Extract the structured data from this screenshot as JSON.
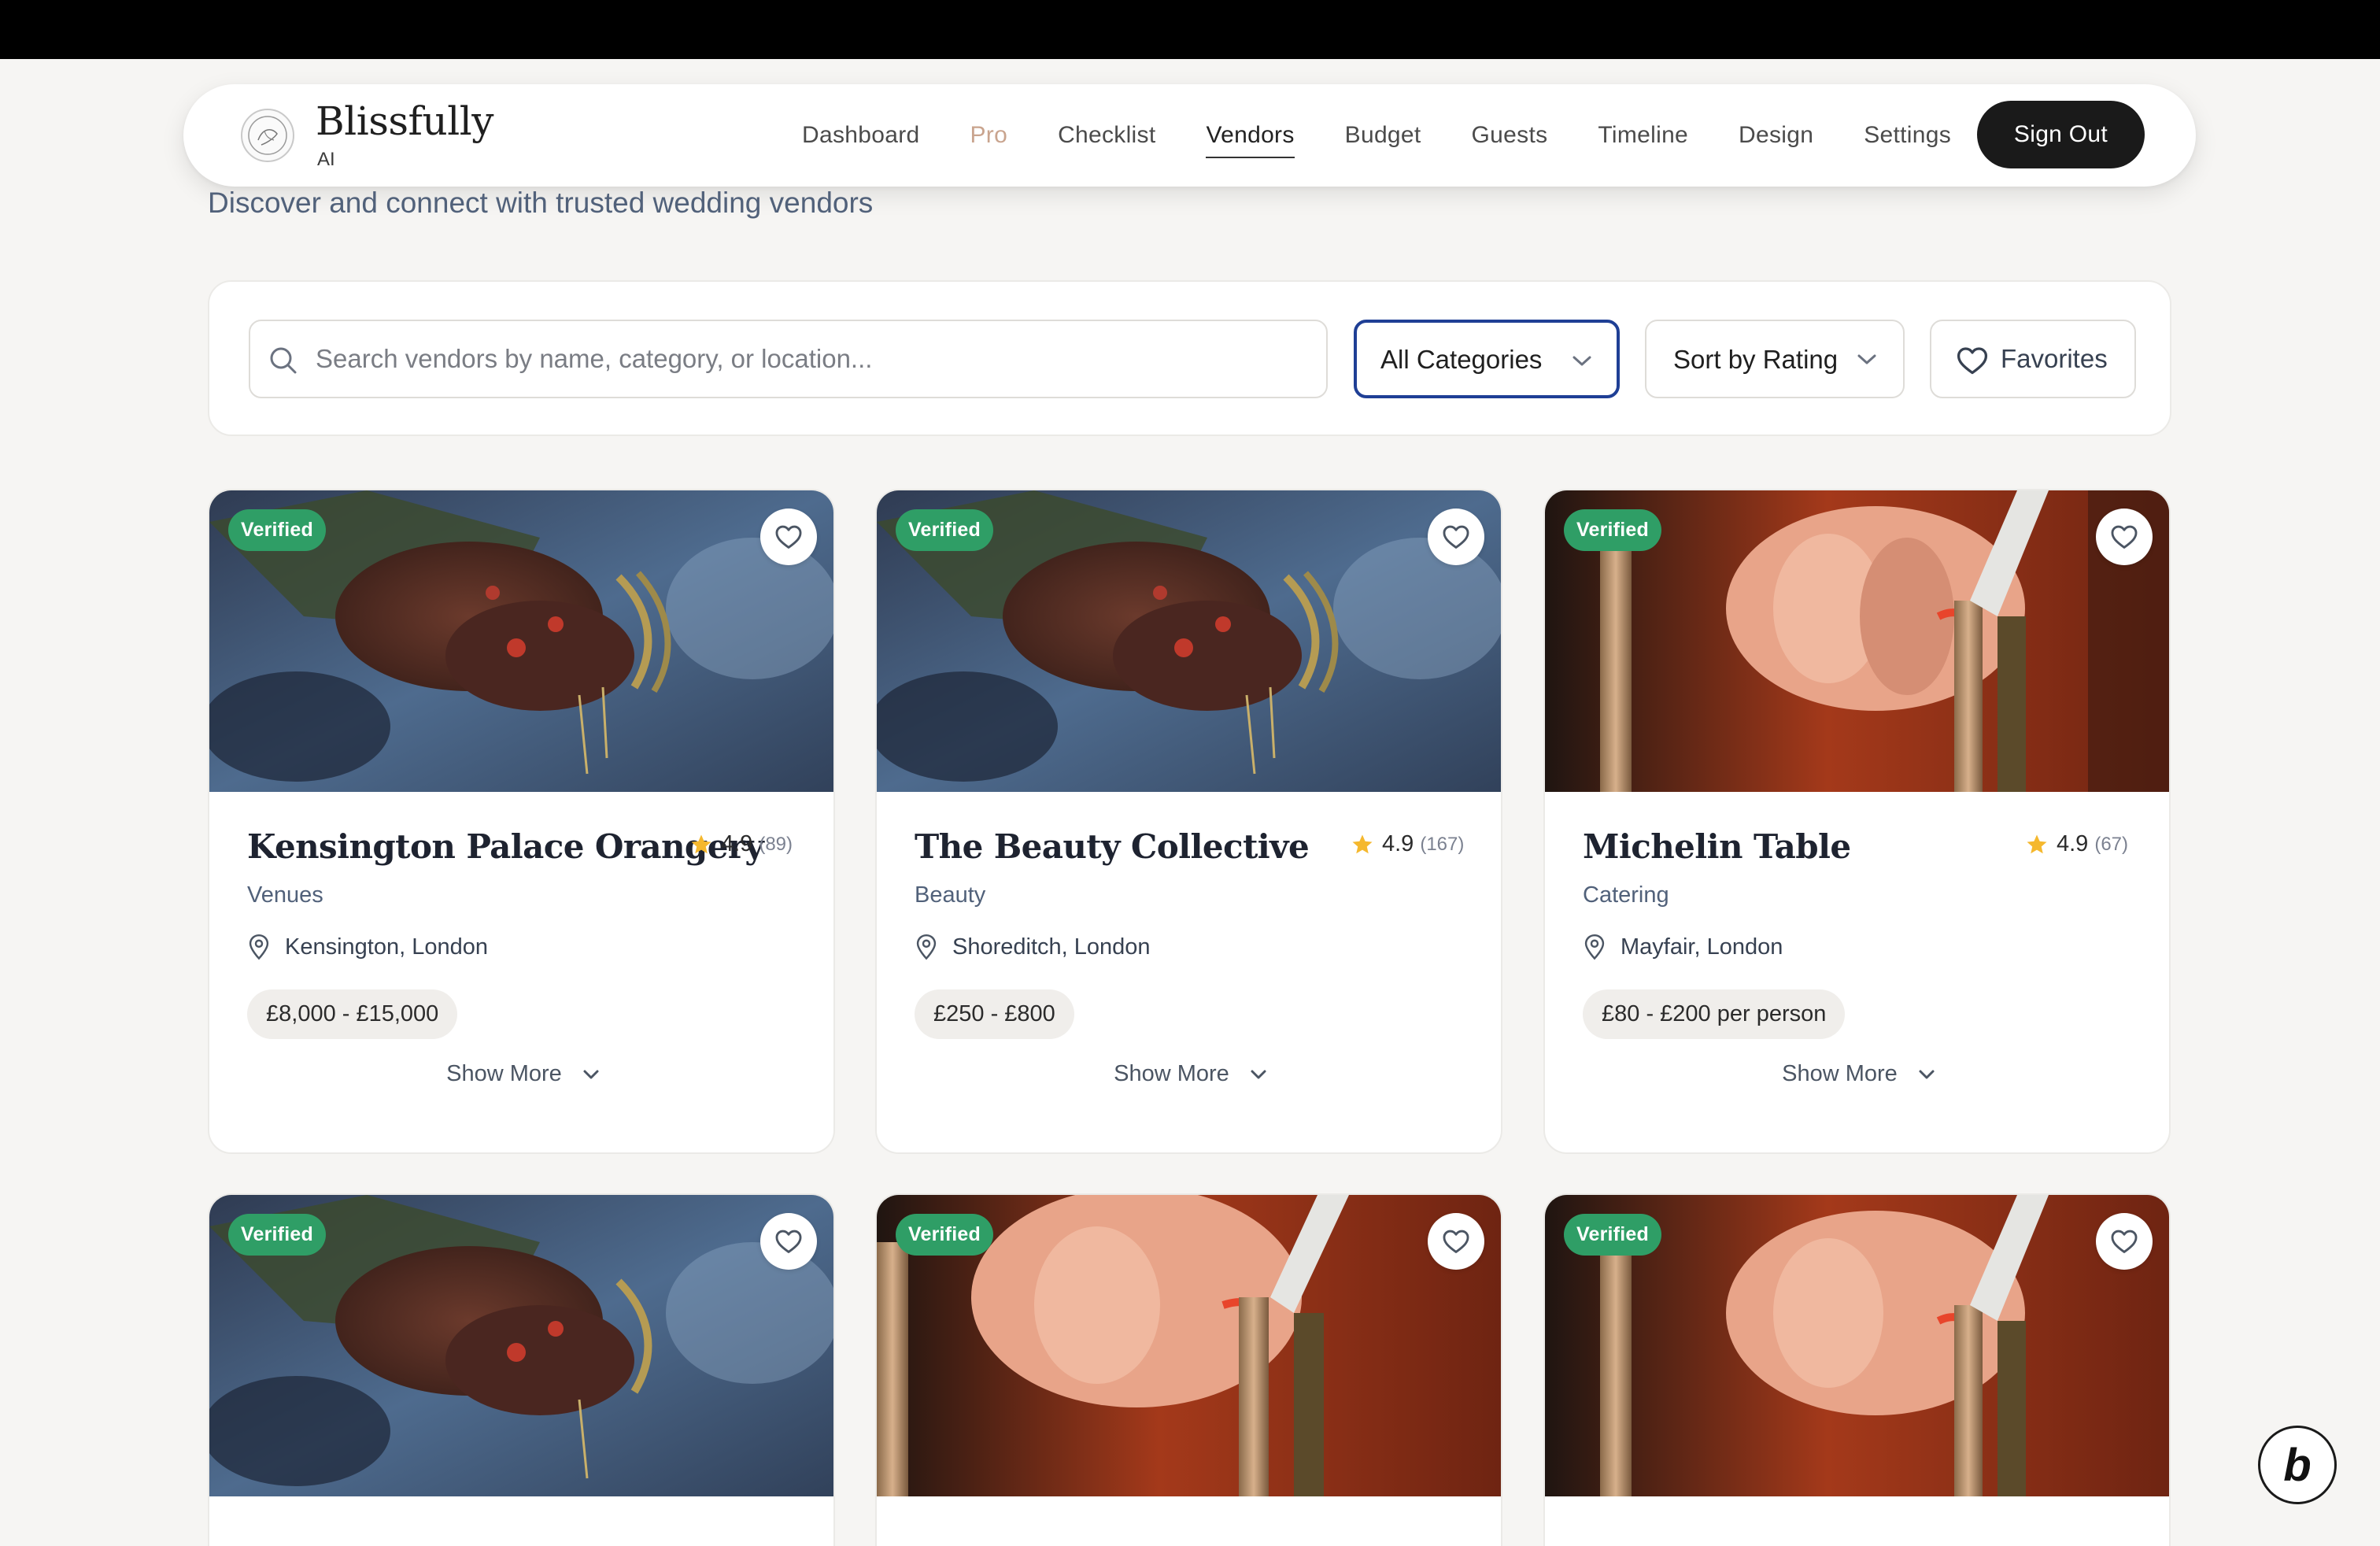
{
  "brand": {
    "name": "Blissfully",
    "sub": "AI"
  },
  "nav": {
    "dashboard": "Dashboard",
    "pro": "Pro",
    "checklist": "Checklist",
    "vendors": "Vendors",
    "budget": "Budget",
    "guests": "Guests",
    "timeline": "Timeline",
    "design": "Design",
    "settings": "Settings",
    "sign_out": "Sign Out"
  },
  "page": {
    "subtitle": "Discover and connect with trusted wedding vendors"
  },
  "filters": {
    "search_placeholder": "Search vendors by name, category, or location...",
    "category_selected": "All Categories",
    "sort_selected": "Sort by Rating",
    "favorites_label": "Favorites"
  },
  "colors": {
    "accent": "#1f3f95",
    "verified": "#2f9e66",
    "pro": "#c9a48e",
    "star": "#f5b82e"
  },
  "vendors": [
    {
      "badge": "Verified",
      "name": "Kensington Palace Orangery",
      "rating": "4.9",
      "reviews": "(89)",
      "category": "Venues",
      "location": "Kensington, London",
      "price": "£8,000 - £15,000",
      "show_more": "Show More",
      "image": "henna-hands"
    },
    {
      "badge": "Verified",
      "name": "The Beauty Collective",
      "rating": "4.9",
      "reviews": "(167)",
      "category": "Beauty",
      "location": "Shoreditch, London",
      "price": "£250 - £800",
      "show_more": "Show More",
      "image": "henna-hands"
    },
    {
      "badge": "Verified",
      "name": "Michelin Table",
      "rating": "4.9",
      "reviews": "(67)",
      "category": "Catering",
      "location": "Mayfair, London",
      "price": "£80 - £200 per person",
      "show_more": "Show More",
      "image": "hand-candles"
    },
    {
      "badge": "Verified",
      "image": "henna-hands"
    },
    {
      "badge": "Verified",
      "image": "hand-candles"
    },
    {
      "badge": "Verified",
      "image": "hand-candles"
    }
  ],
  "icons": {
    "search": "search-icon",
    "chevron": "chevron-down-icon",
    "heart": "heart-icon",
    "star": "star-icon",
    "pin": "map-pin-icon"
  }
}
